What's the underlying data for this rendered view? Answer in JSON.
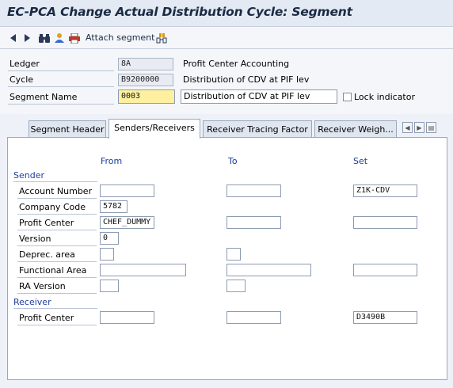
{
  "title": "EC-PCA Change Actual Distribution Cycle: Segment",
  "toolbar": {
    "back_icon": "triangle-left-icon",
    "forward_icon": "triangle-right-icon",
    "find_icon": "binoculars-icon",
    "person_icon": "person-icon",
    "print_icon": "print-icon",
    "attach_label": "Attach segment",
    "overview_icon": "overview-icon"
  },
  "header": {
    "ledger_label": "Ledger",
    "ledger_value": "8A",
    "ledger_desc": "Profit Center Accounting",
    "cycle_label": "Cycle",
    "cycle_value": "B9200000",
    "cycle_desc": "Distribution of CDV at PIF lev",
    "segment_label": "Segment Name",
    "segment_value": "0003",
    "segment_desc": "Distribution of CDV at PIF lev",
    "lock_label": "Lock indicator"
  },
  "tabs": [
    {
      "label": "Segment Header"
    },
    {
      "label": "Senders/Receivers"
    },
    {
      "label": "Receiver Tracing Factor"
    },
    {
      "label": "Receiver Weigh..."
    }
  ],
  "panel": {
    "col_from": "From",
    "col_to": "To",
    "col_set": "Set",
    "sender_group": "Sender",
    "receiver_group": "Receiver",
    "rows": [
      {
        "label": "Account Number",
        "from": "",
        "to": "",
        "set": "Z1K-CDV"
      },
      {
        "label": "Company Code",
        "from": "5782"
      },
      {
        "label": "Profit Center",
        "from": "CHEF_DUMMY",
        "to": "",
        "set": ""
      },
      {
        "label": "Version",
        "from": "0"
      },
      {
        "label": "Deprec. area",
        "from": "",
        "to": ""
      },
      {
        "label": "Functional Area",
        "from": "",
        "to": "",
        "set": ""
      },
      {
        "label": "RA Version",
        "from": "",
        "to": ""
      }
    ],
    "receiver_rows": [
      {
        "label": "Profit Center",
        "from": "",
        "to": "",
        "set": "D3490B"
      }
    ]
  }
}
